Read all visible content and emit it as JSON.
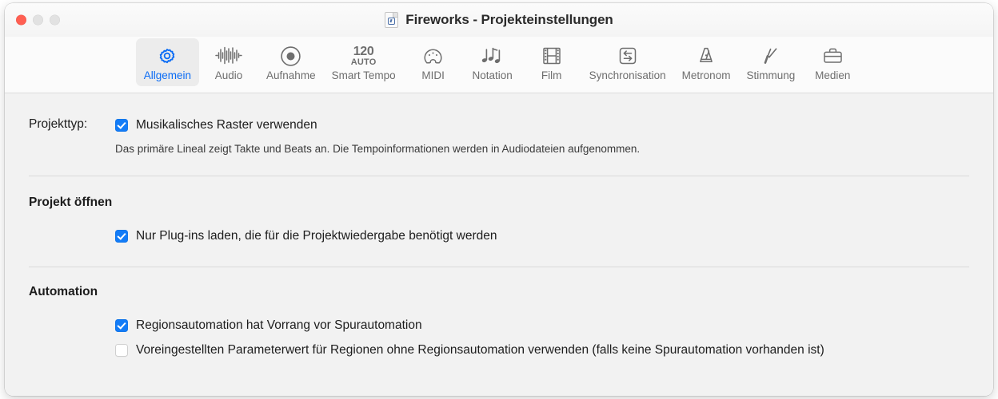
{
  "window": {
    "title": "Fireworks - Projekteinstellungen",
    "doc_icon": "document-icon",
    "traffic_lights": {
      "close": "close-button",
      "minimize": "minimize-button",
      "maximize": "maximize-button"
    },
    "accent_color": "#137cf7",
    "close_color": "#ff5f52"
  },
  "toolbar": {
    "selected": "Allgemein",
    "tabs": [
      {
        "label": "Allgemein",
        "icon": "gear-icon",
        "active": true
      },
      {
        "label": "Audio",
        "icon": "waveform-icon",
        "active": false
      },
      {
        "label": "Aufnahme",
        "icon": "record-icon",
        "active": false
      },
      {
        "label": "Smart Tempo",
        "icon": "tempo-icon",
        "active": false,
        "icon_text_primary": "120",
        "icon_text_secondary": "AUTO"
      },
      {
        "label": "MIDI",
        "icon": "midi-port-icon",
        "active": false
      },
      {
        "label": "Notation",
        "icon": "music-notes-icon",
        "active": false
      },
      {
        "label": "Film",
        "icon": "film-strip-icon",
        "active": false
      },
      {
        "label": "Synchronisation",
        "icon": "sync-arrows-icon",
        "active": false
      },
      {
        "label": "Metronom",
        "icon": "metronome-icon",
        "active": false
      },
      {
        "label": "Stimmung",
        "icon": "tuning-fork-icon",
        "active": false
      },
      {
        "label": "Medien",
        "icon": "briefcase-icon",
        "active": false
      }
    ]
  },
  "main": {
    "project_type": {
      "label": "Projekttyp:",
      "checkbox": {
        "label": "Musikalisches Raster verwenden",
        "checked": true
      },
      "help_text": "Das primäre Lineal zeigt Takte und Beats an. Die Tempoinformationen werden in Audiodateien aufgenommen."
    },
    "open_project": {
      "heading": "Projekt öffnen",
      "checkbox": {
        "label": "Nur Plug-ins laden, die für die Projektwiedergabe benötigt werden",
        "checked": true
      }
    },
    "automation": {
      "heading": "Automation",
      "checkboxes": [
        {
          "label": "Regionsautomation hat Vorrang vor Spurautomation",
          "checked": true
        },
        {
          "label": "Voreingestellten Parameterwert für Regionen ohne Regionsautomation verwenden (falls keine Spurautomation vorhanden ist)",
          "checked": false
        }
      ]
    }
  }
}
